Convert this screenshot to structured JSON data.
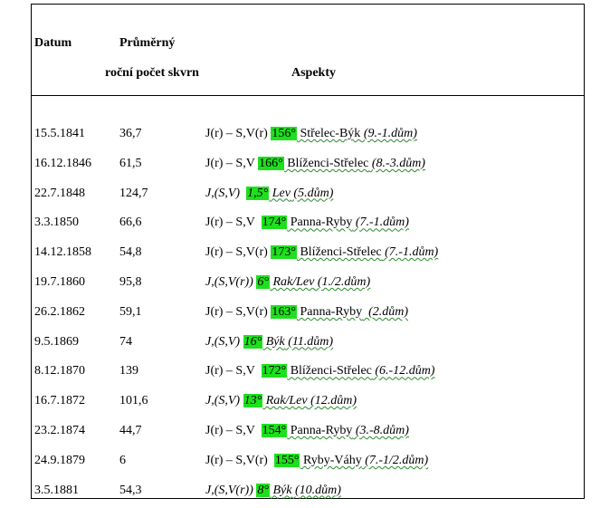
{
  "headers": {
    "datum": "Datum",
    "prumerny": "Průměrný",
    "rocni": "roční počet skvrn",
    "aspekty": "Aspekty"
  },
  "rows": [
    {
      "date": "15.5.1841",
      "count": "36,7",
      "prefix": "J(r) – S,V(r) ",
      "deg": "156°",
      "sign": "Střelec-Býk",
      "house": " (9.-1.dům)",
      "italic": false
    },
    {
      "date": "16.12.1846",
      "count": "61,5",
      "prefix": "J(r) – S,V ",
      "deg": "166°",
      "sign": "Blíženci-Střelec",
      "house": " (8.-3.dům)",
      "italic": false
    },
    {
      "date": "22.7.1848",
      "count": "124,7",
      "prefix": "J,(S,V)  ",
      "deg": "1,5°",
      "sign": "Lev",
      "house": " (5.dům)",
      "italic": true
    },
    {
      "date": "3.3.1850",
      "count": "66,6",
      "prefix": "J(r) – S,V  ",
      "deg": "174°",
      "sign": "Panna-Ryby",
      "house": " (7.-1.dům)",
      "italic": false
    },
    {
      "date": "14.12.1858",
      "count": "54,8",
      "prefix": "J(r) – S,V(r) ",
      "deg": "173°",
      "sign": "Blíženci-Střelec",
      "house": " (7.-1.dům)",
      "italic": false
    },
    {
      "date": "19.7.1860",
      "count": "95,8",
      "prefix": "J,(S,V(r)) ",
      "deg": "6°",
      "sign": "Rak/Lev",
      "house": " (1./2.dům)",
      "italic": true
    },
    {
      "date": "26.2.1862",
      "count": "59,1",
      "prefix": "J(r) – S,V(r) ",
      "deg": "163°",
      "sign": "Panna-Ryby",
      "house": "  (2.dům)",
      "italic": false
    },
    {
      "date": "9.5.1869",
      "count": "74",
      "prefix": "J,(S,V) ",
      "deg": "16°",
      "sign": "Býk",
      "house": " (11.dům)",
      "italic": true
    },
    {
      "date": "8.12.1870",
      "count": "139",
      "prefix": "J(r) – S,V  ",
      "deg": "172°",
      "sign": "Blíženci-Střelec",
      "house": " (6.-12.dům)",
      "italic": false
    },
    {
      "date": "16.7.1872",
      "count": "101,6",
      "prefix": "J,(S,V) ",
      "deg": "13°",
      "sign": "Rak/Lev",
      "house": " (12.dům)",
      "italic": true
    },
    {
      "date": "23.2.1874",
      "count": "44,7",
      "prefix": "J(r) – S,V  ",
      "deg": "154°",
      "sign": "Panna-Ryby",
      "house": " (3.-8.dům)",
      "italic": false
    },
    {
      "date": "24.9.1879",
      "count": "6",
      "prefix": "J(r) – S,V(r)  ",
      "deg": "155°",
      "sign": "Ryby-Váhy",
      "house": " (7.-1/2.dům)",
      "italic": false
    },
    {
      "date": "3.5.1881",
      "count": "54,3",
      "prefix": "J,(S,V(r)) ",
      "deg": "8°",
      "sign": "Býk",
      "house": " (10.dům)",
      "italic": true
    }
  ],
  "colors": {
    "highlight": "#1ee01e",
    "underline": "#2a8a2a"
  }
}
